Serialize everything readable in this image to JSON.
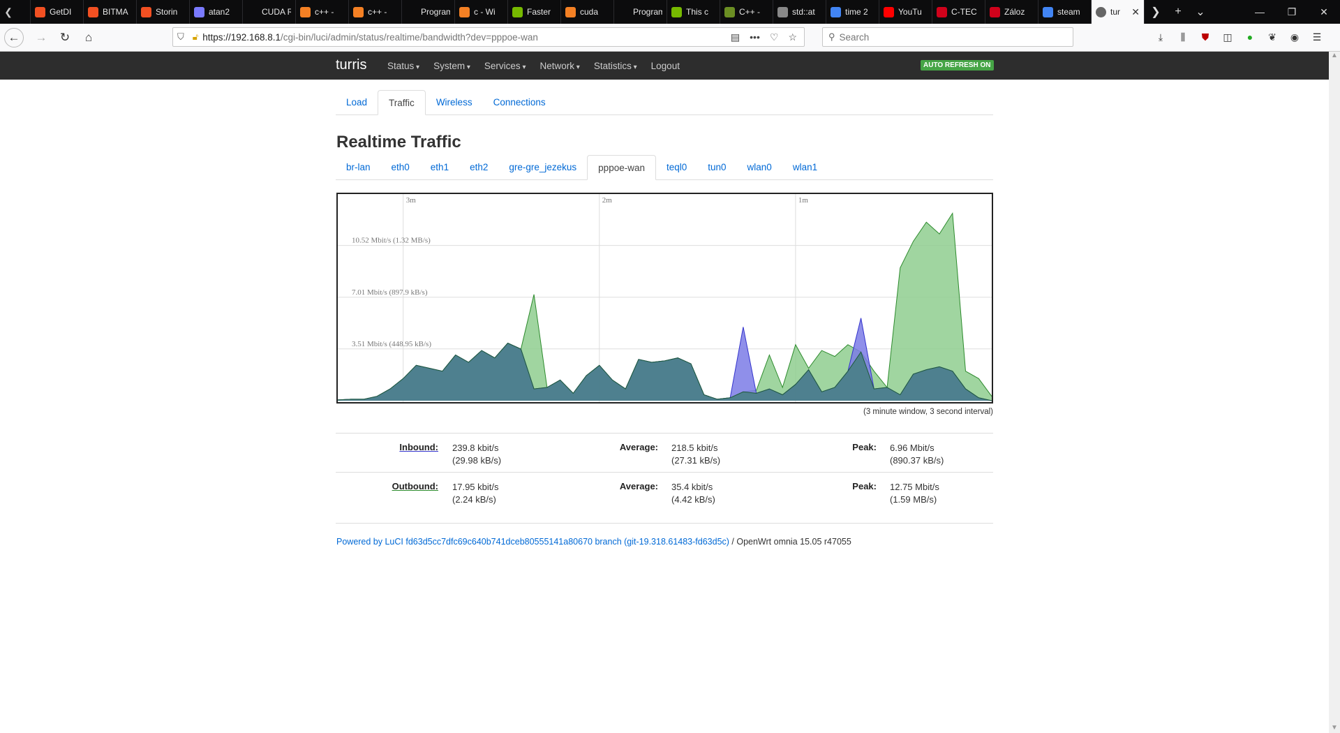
{
  "browser": {
    "tabs": [
      {
        "title": "GetDI",
        "color": "#f25022"
      },
      {
        "title": "BITMA",
        "color": "#f25022"
      },
      {
        "title": "Storin",
        "color": "#f25022"
      },
      {
        "title": "atan2",
        "color": "#7a7aff"
      },
      {
        "title": "CUDA Run",
        "color": "#0c0c0d"
      },
      {
        "title": "c++ -",
        "color": "#f48024"
      },
      {
        "title": "c++ -",
        "color": "#f48024"
      },
      {
        "title": "Programm",
        "color": "#0c0c0d"
      },
      {
        "title": "c - Wi",
        "color": "#f48024"
      },
      {
        "title": "Faster",
        "color": "#76b900"
      },
      {
        "title": "cuda",
        "color": "#f48024"
      },
      {
        "title": "Programm",
        "color": "#0c0c0d"
      },
      {
        "title": "This c",
        "color": "#76b900"
      },
      {
        "title": "C++ -",
        "color": "#6b8e23"
      },
      {
        "title": "std::at",
        "color": "#888888"
      },
      {
        "title": "time 2",
        "color": "#4285f4"
      },
      {
        "title": "YouTu",
        "color": "#ff0000"
      },
      {
        "title": "C-TEC",
        "color": "#d0021b"
      },
      {
        "title": "Záloz",
        "color": "#d0021b"
      },
      {
        "title": "steam",
        "color": "#4285f4"
      }
    ],
    "active_tab": {
      "title": "tur",
      "close": "✕"
    },
    "url_host": "https://192.168.8.1",
    "url_path": "/cgi-bin/luci/admin/status/realtime/bandwidth?dev=pppoe-wan",
    "search_placeholder": "Search"
  },
  "luci": {
    "brand": "turris",
    "menu": [
      "Status",
      "System",
      "Services",
      "Network",
      "Statistics"
    ],
    "logout": "Logout",
    "auto_refresh": "AUTO REFRESH ON",
    "main_tabs": [
      "Load",
      "Traffic",
      "Wireless",
      "Connections"
    ],
    "active_main_tab": "Traffic",
    "page_title": "Realtime Traffic",
    "interfaces": [
      "br-lan",
      "eth0",
      "eth1",
      "eth2",
      "gre-gre_jezekus",
      "pppoe-wan",
      "teql0",
      "tun0",
      "wlan0",
      "wlan1"
    ],
    "active_interface": "pppoe-wan",
    "window_note": "(3 minute window, 3 second interval)",
    "stats": {
      "inbound": {
        "label": "Inbound:",
        "current": "239.8 kbit/s",
        "current_bytes": "(29.98 kB/s)",
        "avg_label": "Average:",
        "avg": "218.5 kbit/s",
        "avg_bytes": "(27.31 kB/s)",
        "peak_label": "Peak:",
        "peak": "6.96 Mbit/s",
        "peak_bytes": "(890.37 kB/s)"
      },
      "outbound": {
        "label": "Outbound:",
        "current": "17.95 kbit/s",
        "current_bytes": "(2.24 kB/s)",
        "avg_label": "Average:",
        "avg": "35.4 kbit/s",
        "avg_bytes": "(4.42 kB/s)",
        "peak_label": "Peak:",
        "peak": "12.75 Mbit/s",
        "peak_bytes": "(1.59 MB/s)"
      }
    },
    "footer_link": "Powered by LuCI fd63d5cc7dfc69c640b741dceb80555141a80670 branch (git-19.318.61483-fd63d5c)",
    "footer_text": " / OpenWrt omnia 15.05 r47055"
  },
  "chart_data": {
    "type": "area",
    "xlabel": "",
    "ylabel": "",
    "x_ticks": [
      "3m",
      "2m",
      "1m"
    ],
    "y_ticks": [
      "3.51 Mbit/s (448.95 kB/s)",
      "7.01 Mbit/s (897.9 kB/s)",
      "10.52 Mbit/s (1.32 MB/s)"
    ],
    "y_tick_values": [
      3.51,
      7.01,
      10.52
    ],
    "ylim": [
      0,
      14
    ],
    "x_unit": "seconds ago",
    "x": [
      200,
      196,
      192,
      188,
      184,
      180,
      176,
      172,
      168,
      164,
      160,
      156,
      152,
      148,
      144,
      140,
      136,
      132,
      128,
      124,
      120,
      116,
      112,
      108,
      104,
      100,
      96,
      92,
      88,
      84,
      80,
      76,
      72,
      68,
      64,
      60,
      56,
      52,
      48,
      44,
      40,
      36,
      32,
      28,
      24,
      20,
      16,
      12,
      8,
      4,
      0
    ],
    "series": [
      {
        "name": "Inbound",
        "color": "#3333cc",
        "fill": "#7b7be6",
        "values": [
          0.05,
          0.1,
          0.1,
          0.3,
          0.8,
          1.5,
          2.4,
          2.2,
          2.0,
          3.1,
          2.6,
          3.4,
          2.9,
          3.9,
          3.5,
          0.8,
          0.9,
          1.4,
          0.5,
          1.7,
          2.4,
          1.4,
          0.8,
          2.8,
          2.6,
          2.7,
          2.9,
          2.5,
          0.4,
          0.1,
          0.2,
          5.0,
          0.5,
          0.8,
          0.4,
          1.1,
          2.1,
          0.6,
          0.9,
          2.0,
          5.6,
          0.8,
          0.9,
          0.4,
          1.8,
          2.1,
          2.3,
          2.0,
          0.8,
          0.2,
          0.0
        ]
      },
      {
        "name": "Outbound",
        "color": "#2c8a2c",
        "fill": "#8fce8f",
        "values": [
          0.05,
          0.1,
          0.1,
          0.3,
          0.8,
          1.5,
          2.4,
          2.2,
          2.0,
          3.1,
          2.6,
          3.4,
          2.9,
          3.9,
          3.5,
          7.2,
          0.9,
          1.4,
          0.5,
          1.7,
          2.4,
          1.4,
          0.8,
          2.8,
          2.6,
          2.7,
          2.9,
          2.5,
          0.4,
          0.1,
          0.2,
          0.6,
          0.7,
          3.1,
          0.9,
          3.8,
          2.2,
          3.4,
          3.0,
          3.8,
          3.3,
          2.0,
          0.9,
          9.0,
          10.8,
          12.1,
          11.3,
          12.7,
          2.0,
          1.5,
          0.3
        ]
      }
    ]
  }
}
